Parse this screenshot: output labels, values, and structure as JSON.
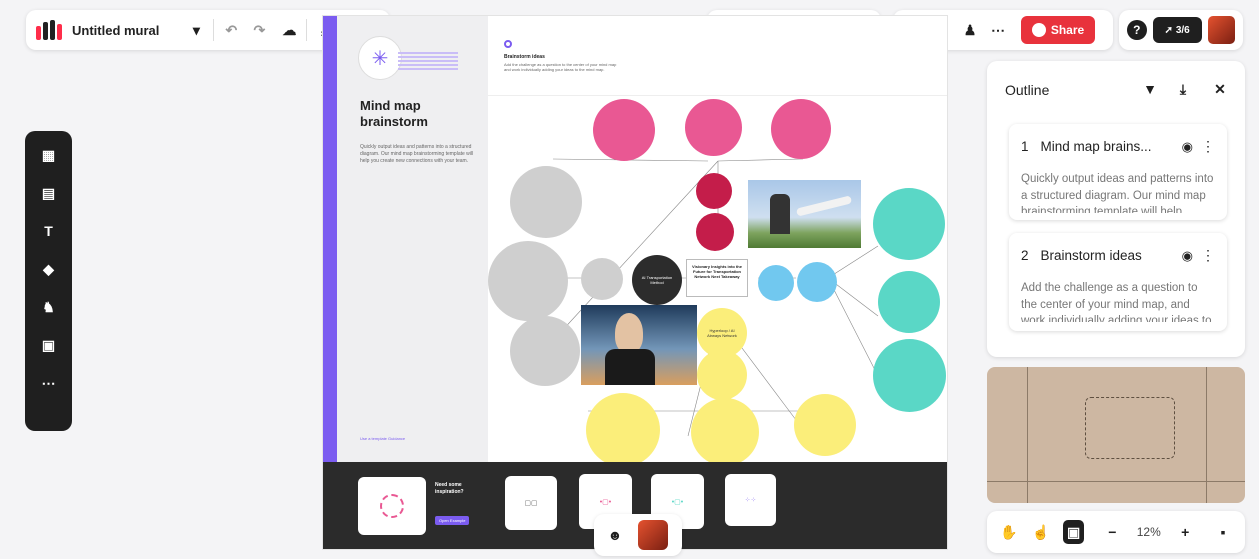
{
  "toolbar": {
    "title": "Untitled mural",
    "share_label": "Share",
    "collab_count": "3/6"
  },
  "canvas": {
    "left_panel_title": "Mind map brainstorm",
    "left_panel_desc": "Quickly output ideas and patterns into a structured diagram. Our mind map brainstorming template will help you create new connections with your team.",
    "section_title": "Brainstorm ideas",
    "section_desc": "Add the challenge as a question to the center of your mind map and work individually adding your ideas to the mind map.",
    "center_node": "Visionary Insights into the Future for Transportation Network Next Takeaway",
    "ai_node": "AI Transportation Method",
    "yellow_top": "Hyperloop / AI Airways Network",
    "strip_label": "Need some inspiration?",
    "strip_button": "Open Example",
    "footer_link": "Use a template Guidance"
  },
  "outline": {
    "title": "Outline",
    "items": [
      {
        "num": "1",
        "title": "Mind map brains...",
        "desc": "Quickly output ideas and patterns into a structured diagram. Our mind map brainstorming template will help"
      },
      {
        "num": "2",
        "title": "Brainstorm ideas",
        "desc": "Add the challenge as a question to the center of your mind map, and work individually adding your ideas to the mind map."
      }
    ]
  },
  "zoom": {
    "level": "12%"
  },
  "colors": {
    "accent": "#7b5cf0",
    "share": "#e8323c",
    "pink": "#e95893",
    "teal": "#5ad7c6",
    "yellow": "#fbee7a"
  }
}
